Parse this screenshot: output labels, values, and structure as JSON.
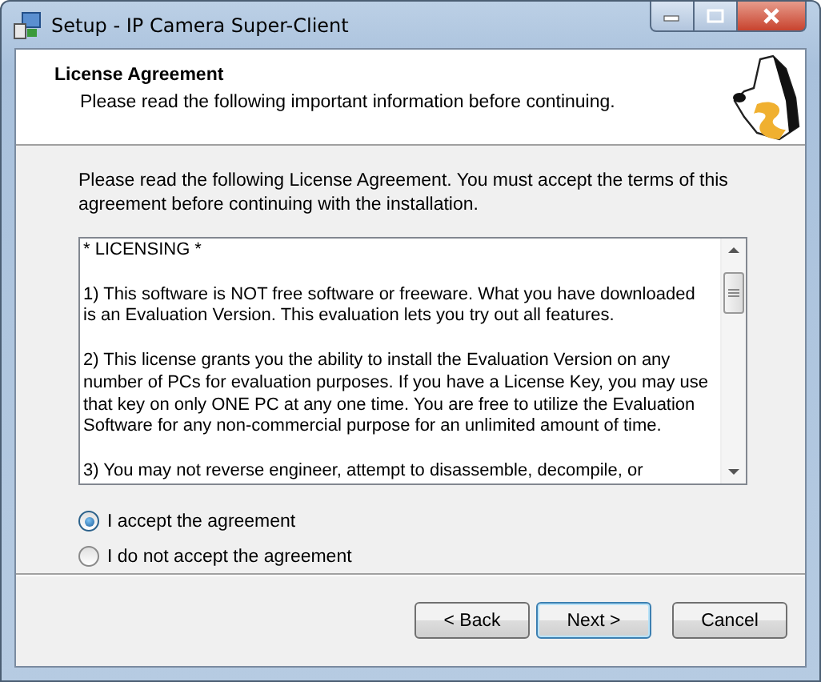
{
  "window": {
    "title": "Setup - IP Camera Super-Client"
  },
  "header": {
    "title": "License Agreement",
    "subtitle": "Please read the following important information before continuing."
  },
  "intro": [
    "Please read the following License Agreement. You must accept the terms of this",
    "agreement before continuing with the installation."
  ],
  "license_text": [
    {
      "lines": [
        "* LICENSING *"
      ]
    },
    {
      "lines": [
        "1) This software is NOT free software or freeware. What you have downloaded",
        "is an Evaluation Version. This evaluation lets you try out all features."
      ]
    },
    {
      "lines": [
        "2) This license grants you the ability to install the Evaluation Version on any",
        "number of PCs for evaluation purposes. If you have a License Key, you may use",
        "that key on only ONE PC at any one time. You are free to utilize the Evaluation",
        "Software for any non-commercial purpose for an unlimited amount of time."
      ]
    },
    {
      "lines": [
        "3) You may not reverse engineer, attempt to disassemble, decompile, or"
      ]
    }
  ],
  "options": [
    {
      "label": "I accept the agreement",
      "selected": true
    },
    {
      "label": "I do not accept the agreement",
      "selected": false
    }
  ],
  "buttons": [
    {
      "label": "< Back",
      "kind": "normal"
    },
    {
      "label": "Next >",
      "kind": "default"
    },
    {
      "label": "Cancel",
      "kind": "cancel"
    }
  ]
}
